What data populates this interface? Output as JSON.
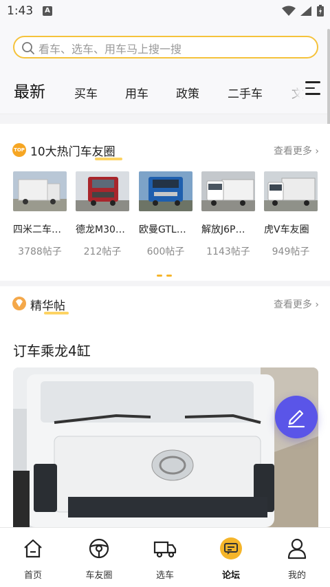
{
  "status_bar": {
    "time": "1:43",
    "notification_icon": "A"
  },
  "search": {
    "placeholder": "看车、选车、用车马上搜一搜"
  },
  "tabs": [
    {
      "label": "最新",
      "active": true
    },
    {
      "label": "买车"
    },
    {
      "label": "用车"
    },
    {
      "label": "政策"
    },
    {
      "label": "二手车"
    },
    {
      "label": "文"
    }
  ],
  "hot_circles": {
    "badge": "TOP",
    "title": "10大热门车友圈",
    "more": "查看更多",
    "items": [
      {
        "name": "四米二车…",
        "count": "3788帖子"
      },
      {
        "name": "德龙M30…",
        "count": "212帖子"
      },
      {
        "name": "欧曼GTL…",
        "count": "600帖子"
      },
      {
        "name": "解放J6P…",
        "count": "1143帖子"
      },
      {
        "name": "虎V车友圈",
        "count": "949帖子"
      }
    ]
  },
  "featured": {
    "title": "精华帖",
    "more": "查看更多",
    "post_title": "订车乘龙4缸"
  },
  "bottom_nav": [
    {
      "label": "首页",
      "icon": "home-icon"
    },
    {
      "label": "车友圈",
      "icon": "steering-wheel-icon"
    },
    {
      "label": "选车",
      "icon": "truck-icon"
    },
    {
      "label": "论坛",
      "icon": "forum-icon",
      "active": true
    },
    {
      "label": "我的",
      "icon": "person-icon"
    }
  ],
  "colors": {
    "accent": "#f5c23a",
    "fab": "#5a55e8",
    "forum_active": "#f5b52a"
  }
}
